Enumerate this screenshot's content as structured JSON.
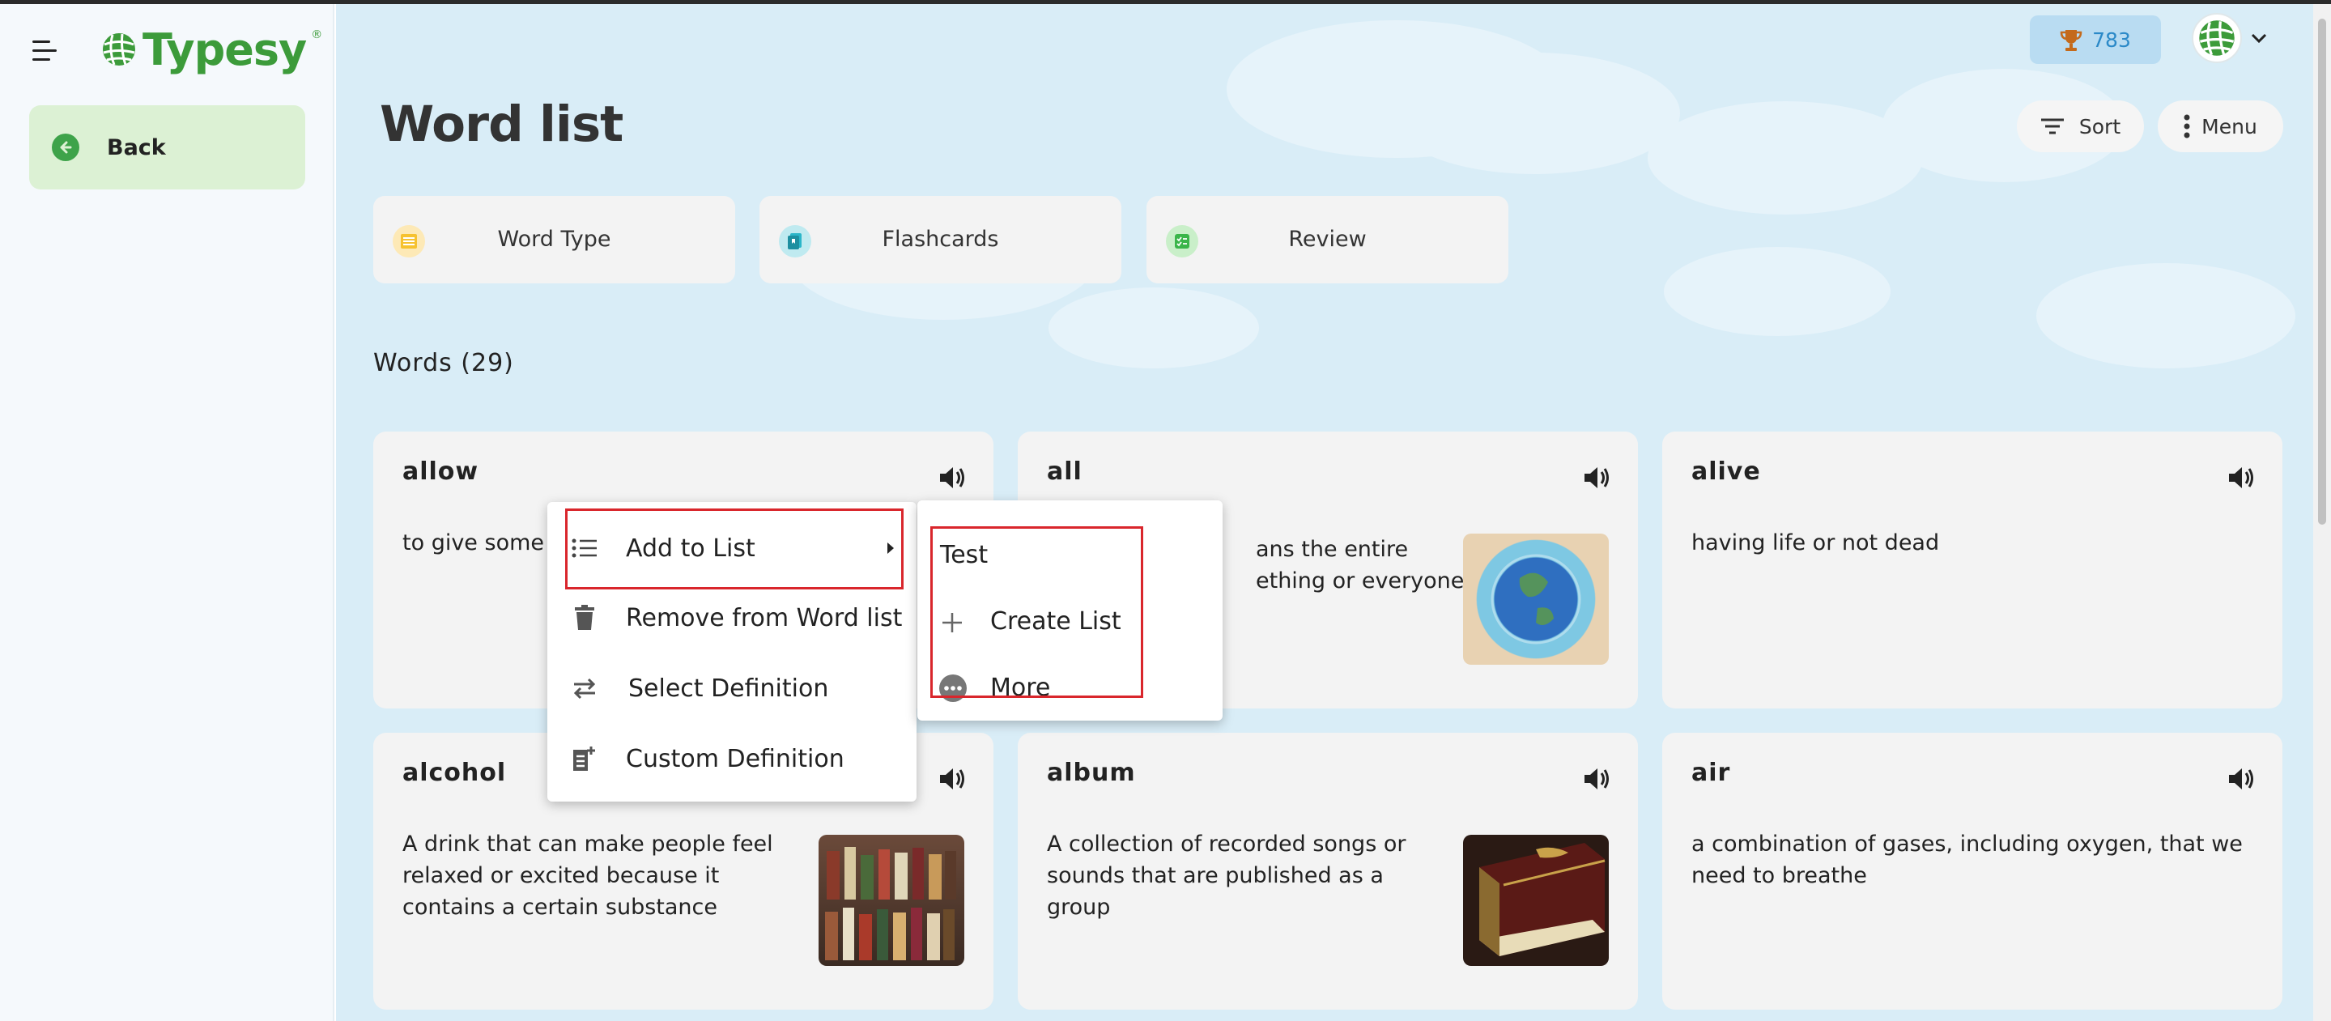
{
  "sidebar": {
    "logo_text": "Typesy",
    "logo_mark": "®",
    "back_label": "Back"
  },
  "header": {
    "points": "783",
    "page_title": "Word list",
    "sort_label": "Sort",
    "menu_label": "Menu"
  },
  "features": [
    {
      "label": "Word Type",
      "icon": "keyboard-icon",
      "color": "#f6c230"
    },
    {
      "label": "Flashcards",
      "icon": "flashcards-icon",
      "color": "#2bb6c9"
    },
    {
      "label": "Review",
      "icon": "review-icon",
      "color": "#3ab54a"
    }
  ],
  "words_heading": "Words (29)",
  "cards": [
    {
      "word": "allow",
      "definition": "to give some"
    },
    {
      "word": "all",
      "definition_line1": "ans the entire",
      "definition_line2": "ething or everyone"
    },
    {
      "word": "alive",
      "definition": "having life or not dead"
    },
    {
      "word": "alcohol",
      "definition": "A drink that can make people feel relaxed or excited because it contains a certain substance"
    },
    {
      "word": "album",
      "definition": "A collection of recorded songs or sounds that are published as a group"
    },
    {
      "word": "air",
      "definition": "a combination of gases, including oxygen, that we need to breathe"
    }
  ],
  "context_menu": {
    "items": [
      {
        "label": "Add to List",
        "icon": "list-icon"
      },
      {
        "label": "Remove from Word list",
        "icon": "trash-icon"
      },
      {
        "label": "Select Definition",
        "icon": "swap-icon"
      },
      {
        "label": "Custom Definition",
        "icon": "custom-definition-icon"
      }
    ]
  },
  "submenu": {
    "items": [
      {
        "label": "Test"
      },
      {
        "label": "Create List",
        "icon": "plus-icon"
      },
      {
        "label": "More",
        "icon": "more-icon"
      }
    ]
  },
  "colors": {
    "brand_green": "#3c9b3a",
    "highlight_red": "#d9262c",
    "main_bg": "#d9edf7",
    "points_bg": "#b9dcf2"
  }
}
